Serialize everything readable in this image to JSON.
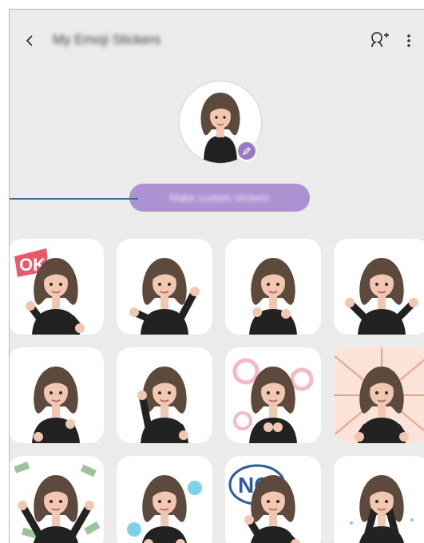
{
  "header": {
    "title": "My Emoji Stickers",
    "back_icon": "chevron-left-icon",
    "add_icon": "add-person-icon",
    "more_icon": "more-vertical-icon"
  },
  "profile": {
    "edit_icon": "pencil-icon"
  },
  "actions": {
    "make_custom_label": "Make custom stickers"
  },
  "stickers": [
    {
      "kind": "ok"
    },
    {
      "kind": "surprised"
    },
    {
      "kind": "thumbs"
    },
    {
      "kind": "shrug"
    },
    {
      "kind": "happy"
    },
    {
      "kind": "wave"
    },
    {
      "kind": "rings"
    },
    {
      "kind": "angry"
    },
    {
      "kind": "money"
    },
    {
      "kind": "sleepy"
    },
    {
      "kind": "no"
    },
    {
      "kind": "facepalm"
    }
  ],
  "colors": {
    "accent": "#ae91d2",
    "background": "#ebebeb",
    "hair": "#5e4a3c",
    "skin": "#f1c7b2",
    "shirt": "#222222"
  }
}
